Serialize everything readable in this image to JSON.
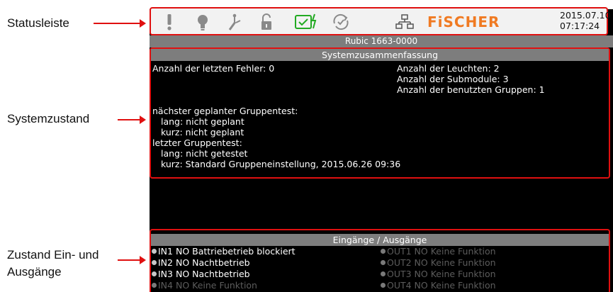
{
  "callouts": {
    "statusbar": "Statusleiste",
    "system_state": "Systemzustand",
    "io_state_line1": "Zustand Ein- und",
    "io_state_line2": "Ausgänge"
  },
  "statusbar": {
    "icons": [
      "alarm-icon",
      "lamp-icon",
      "test-tool-icon",
      "unlock-icon",
      "battery-charging-icon",
      "refresh-check-icon",
      "network-icon"
    ],
    "brand": "FiSCHER",
    "date": "2015.07.10",
    "time": "07:17:24",
    "colors": {
      "brand": "#f07a22",
      "charging": "#22aa22",
      "highlight": "#e01010"
    }
  },
  "device_name": "Rubic 1663-0000",
  "summary": {
    "header": "Systemzusammenfassung",
    "last_errors": "Anzahl der letzten Fehler: 0",
    "lamp_count": "Anzahl der Leuchten: 2",
    "submodule_count": "Anzahl der Submodule: 3",
    "group_count": "Anzahl der benutzten Gruppen: 1",
    "next_test_title": "nächster geplanter Gruppentest:",
    "next_long": "lang: nicht geplant",
    "next_short": "kurz: nicht geplant",
    "last_test_title": "letzter Gruppentest:",
    "last_long": "lang: nicht getestet",
    "last_short": "kurz: Standard Gruppeneinstellung, 2015.06.26 09:36"
  },
  "io": {
    "header": "Eingänge / Ausgänge",
    "inputs": [
      {
        "label": "IN1 NO Battriebetrieb blockiert",
        "active": true
      },
      {
        "label": "IN2 NO Nachtbetrieb",
        "active": true
      },
      {
        "label": "IN3 NO Nachtbetrieb",
        "active": true
      },
      {
        "label": "IN4 NO Keine Funktion",
        "active": false
      }
    ],
    "outputs": [
      {
        "label": "OUT1 NO Keine Funktion",
        "active": false
      },
      {
        "label": "OUT2 NO Keine Funktion",
        "active": false
      },
      {
        "label": "OUT3 NO Keine Funktion",
        "active": false
      },
      {
        "label": "OUT4 NO Keine Funktion",
        "active": false
      }
    ]
  }
}
